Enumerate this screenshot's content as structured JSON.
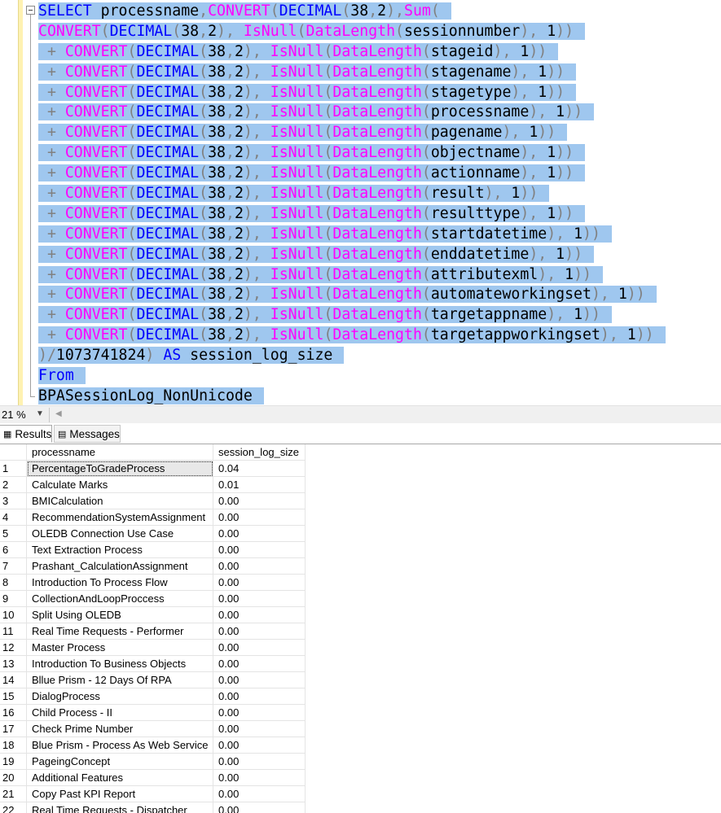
{
  "editor": {
    "lines": [
      [
        [
          "kw",
          "SELECT"
        ],
        [
          "tx",
          " processname"
        ],
        [
          "gr",
          ","
        ],
        [
          "fn",
          "CONVERT"
        ],
        [
          "gr",
          "("
        ],
        [
          "kw",
          "DECIMAL"
        ],
        [
          "gr",
          "("
        ],
        [
          "tx",
          "38"
        ],
        [
          "gr",
          ","
        ],
        [
          "tx",
          "2"
        ],
        [
          "gr",
          "),"
        ],
        [
          "fn",
          "Sum"
        ],
        [
          "gr",
          "("
        ]
      ],
      [
        [
          "fn",
          "CONVERT"
        ],
        [
          "gr",
          "("
        ],
        [
          "kw",
          "DECIMAL"
        ],
        [
          "gr",
          "("
        ],
        [
          "tx",
          "38"
        ],
        [
          "gr",
          ","
        ],
        [
          "tx",
          "2"
        ],
        [
          "gr",
          "), "
        ],
        [
          "fn",
          "IsNull"
        ],
        [
          "gr",
          "("
        ],
        [
          "fn",
          "DataLength"
        ],
        [
          "gr",
          "("
        ],
        [
          "tx",
          "sessionnumber"
        ],
        [
          "gr",
          "), "
        ],
        [
          "tx",
          "1"
        ],
        [
          "gr",
          "))"
        ]
      ],
      [
        [
          "gr",
          " + "
        ],
        [
          "fn",
          "CONVERT"
        ],
        [
          "gr",
          "("
        ],
        [
          "kw",
          "DECIMAL"
        ],
        [
          "gr",
          "("
        ],
        [
          "tx",
          "38"
        ],
        [
          "gr",
          ","
        ],
        [
          "tx",
          "2"
        ],
        [
          "gr",
          "), "
        ],
        [
          "fn",
          "IsNull"
        ],
        [
          "gr",
          "("
        ],
        [
          "fn",
          "DataLength"
        ],
        [
          "gr",
          "("
        ],
        [
          "tx",
          "stageid"
        ],
        [
          "gr",
          "), "
        ],
        [
          "tx",
          "1"
        ],
        [
          "gr",
          "))"
        ]
      ],
      [
        [
          "gr",
          " + "
        ],
        [
          "fn",
          "CONVERT"
        ],
        [
          "gr",
          "("
        ],
        [
          "kw",
          "DECIMAL"
        ],
        [
          "gr",
          "("
        ],
        [
          "tx",
          "38"
        ],
        [
          "gr",
          ","
        ],
        [
          "tx",
          "2"
        ],
        [
          "gr",
          "), "
        ],
        [
          "fn",
          "IsNull"
        ],
        [
          "gr",
          "("
        ],
        [
          "fn",
          "DataLength"
        ],
        [
          "gr",
          "("
        ],
        [
          "tx",
          "stagename"
        ],
        [
          "gr",
          "), "
        ],
        [
          "tx",
          "1"
        ],
        [
          "gr",
          "))"
        ]
      ],
      [
        [
          "gr",
          " + "
        ],
        [
          "fn",
          "CONVERT"
        ],
        [
          "gr",
          "("
        ],
        [
          "kw",
          "DECIMAL"
        ],
        [
          "gr",
          "("
        ],
        [
          "tx",
          "38"
        ],
        [
          "gr",
          ","
        ],
        [
          "tx",
          "2"
        ],
        [
          "gr",
          "), "
        ],
        [
          "fn",
          "IsNull"
        ],
        [
          "gr",
          "("
        ],
        [
          "fn",
          "DataLength"
        ],
        [
          "gr",
          "("
        ],
        [
          "tx",
          "stagetype"
        ],
        [
          "gr",
          "), "
        ],
        [
          "tx",
          "1"
        ],
        [
          "gr",
          "))"
        ]
      ],
      [
        [
          "gr",
          " + "
        ],
        [
          "fn",
          "CONVERT"
        ],
        [
          "gr",
          "("
        ],
        [
          "kw",
          "DECIMAL"
        ],
        [
          "gr",
          "("
        ],
        [
          "tx",
          "38"
        ],
        [
          "gr",
          ","
        ],
        [
          "tx",
          "2"
        ],
        [
          "gr",
          "), "
        ],
        [
          "fn",
          "IsNull"
        ],
        [
          "gr",
          "("
        ],
        [
          "fn",
          "DataLength"
        ],
        [
          "gr",
          "("
        ],
        [
          "tx",
          "processname"
        ],
        [
          "gr",
          "), "
        ],
        [
          "tx",
          "1"
        ],
        [
          "gr",
          "))"
        ]
      ],
      [
        [
          "gr",
          " + "
        ],
        [
          "fn",
          "CONVERT"
        ],
        [
          "gr",
          "("
        ],
        [
          "kw",
          "DECIMAL"
        ],
        [
          "gr",
          "("
        ],
        [
          "tx",
          "38"
        ],
        [
          "gr",
          ","
        ],
        [
          "tx",
          "2"
        ],
        [
          "gr",
          "), "
        ],
        [
          "fn",
          "IsNull"
        ],
        [
          "gr",
          "("
        ],
        [
          "fn",
          "DataLength"
        ],
        [
          "gr",
          "("
        ],
        [
          "tx",
          "pagename"
        ],
        [
          "gr",
          "), "
        ],
        [
          "tx",
          "1"
        ],
        [
          "gr",
          "))"
        ]
      ],
      [
        [
          "gr",
          " + "
        ],
        [
          "fn",
          "CONVERT"
        ],
        [
          "gr",
          "("
        ],
        [
          "kw",
          "DECIMAL"
        ],
        [
          "gr",
          "("
        ],
        [
          "tx",
          "38"
        ],
        [
          "gr",
          ","
        ],
        [
          "tx",
          "2"
        ],
        [
          "gr",
          "), "
        ],
        [
          "fn",
          "IsNull"
        ],
        [
          "gr",
          "("
        ],
        [
          "fn",
          "DataLength"
        ],
        [
          "gr",
          "("
        ],
        [
          "tx",
          "objectname"
        ],
        [
          "gr",
          "), "
        ],
        [
          "tx",
          "1"
        ],
        [
          "gr",
          "))"
        ]
      ],
      [
        [
          "gr",
          " + "
        ],
        [
          "fn",
          "CONVERT"
        ],
        [
          "gr",
          "("
        ],
        [
          "kw",
          "DECIMAL"
        ],
        [
          "gr",
          "("
        ],
        [
          "tx",
          "38"
        ],
        [
          "gr",
          ","
        ],
        [
          "tx",
          "2"
        ],
        [
          "gr",
          "), "
        ],
        [
          "fn",
          "IsNull"
        ],
        [
          "gr",
          "("
        ],
        [
          "fn",
          "DataLength"
        ],
        [
          "gr",
          "("
        ],
        [
          "tx",
          "actionname"
        ],
        [
          "gr",
          "), "
        ],
        [
          "tx",
          "1"
        ],
        [
          "gr",
          "))"
        ]
      ],
      [
        [
          "gr",
          " + "
        ],
        [
          "fn",
          "CONVERT"
        ],
        [
          "gr",
          "("
        ],
        [
          "kw",
          "DECIMAL"
        ],
        [
          "gr",
          "("
        ],
        [
          "tx",
          "38"
        ],
        [
          "gr",
          ","
        ],
        [
          "tx",
          "2"
        ],
        [
          "gr",
          "), "
        ],
        [
          "fn",
          "IsNull"
        ],
        [
          "gr",
          "("
        ],
        [
          "fn",
          "DataLength"
        ],
        [
          "gr",
          "("
        ],
        [
          "tx",
          "result"
        ],
        [
          "gr",
          "), "
        ],
        [
          "tx",
          "1"
        ],
        [
          "gr",
          "))"
        ]
      ],
      [
        [
          "gr",
          " + "
        ],
        [
          "fn",
          "CONVERT"
        ],
        [
          "gr",
          "("
        ],
        [
          "kw",
          "DECIMAL"
        ],
        [
          "gr",
          "("
        ],
        [
          "tx",
          "38"
        ],
        [
          "gr",
          ","
        ],
        [
          "tx",
          "2"
        ],
        [
          "gr",
          "), "
        ],
        [
          "fn",
          "IsNull"
        ],
        [
          "gr",
          "("
        ],
        [
          "fn",
          "DataLength"
        ],
        [
          "gr",
          "("
        ],
        [
          "tx",
          "resulttype"
        ],
        [
          "gr",
          "), "
        ],
        [
          "tx",
          "1"
        ],
        [
          "gr",
          "))"
        ]
      ],
      [
        [
          "gr",
          " + "
        ],
        [
          "fn",
          "CONVERT"
        ],
        [
          "gr",
          "("
        ],
        [
          "kw",
          "DECIMAL"
        ],
        [
          "gr",
          "("
        ],
        [
          "tx",
          "38"
        ],
        [
          "gr",
          ","
        ],
        [
          "tx",
          "2"
        ],
        [
          "gr",
          "), "
        ],
        [
          "fn",
          "IsNull"
        ],
        [
          "gr",
          "("
        ],
        [
          "fn",
          "DataLength"
        ],
        [
          "gr",
          "("
        ],
        [
          "tx",
          "startdatetime"
        ],
        [
          "gr",
          "), "
        ],
        [
          "tx",
          "1"
        ],
        [
          "gr",
          "))"
        ]
      ],
      [
        [
          "gr",
          " + "
        ],
        [
          "fn",
          "CONVERT"
        ],
        [
          "gr",
          "("
        ],
        [
          "kw",
          "DECIMAL"
        ],
        [
          "gr",
          "("
        ],
        [
          "tx",
          "38"
        ],
        [
          "gr",
          ","
        ],
        [
          "tx",
          "2"
        ],
        [
          "gr",
          "), "
        ],
        [
          "fn",
          "IsNull"
        ],
        [
          "gr",
          "("
        ],
        [
          "fn",
          "DataLength"
        ],
        [
          "gr",
          "("
        ],
        [
          "tx",
          "enddatetime"
        ],
        [
          "gr",
          "), "
        ],
        [
          "tx",
          "1"
        ],
        [
          "gr",
          "))"
        ]
      ],
      [
        [
          "gr",
          " + "
        ],
        [
          "fn",
          "CONVERT"
        ],
        [
          "gr",
          "("
        ],
        [
          "kw",
          "DECIMAL"
        ],
        [
          "gr",
          "("
        ],
        [
          "tx",
          "38"
        ],
        [
          "gr",
          ","
        ],
        [
          "tx",
          "2"
        ],
        [
          "gr",
          "), "
        ],
        [
          "fn",
          "IsNull"
        ],
        [
          "gr",
          "("
        ],
        [
          "fn",
          "DataLength"
        ],
        [
          "gr",
          "("
        ],
        [
          "tx",
          "attributexml"
        ],
        [
          "gr",
          "), "
        ],
        [
          "tx",
          "1"
        ],
        [
          "gr",
          "))"
        ]
      ],
      [
        [
          "gr",
          " + "
        ],
        [
          "fn",
          "CONVERT"
        ],
        [
          "gr",
          "("
        ],
        [
          "kw",
          "DECIMAL"
        ],
        [
          "gr",
          "("
        ],
        [
          "tx",
          "38"
        ],
        [
          "gr",
          ","
        ],
        [
          "tx",
          "2"
        ],
        [
          "gr",
          "), "
        ],
        [
          "fn",
          "IsNull"
        ],
        [
          "gr",
          "("
        ],
        [
          "fn",
          "DataLength"
        ],
        [
          "gr",
          "("
        ],
        [
          "tx",
          "automateworkingset"
        ],
        [
          "gr",
          "), "
        ],
        [
          "tx",
          "1"
        ],
        [
          "gr",
          "))"
        ]
      ],
      [
        [
          "gr",
          " + "
        ],
        [
          "fn",
          "CONVERT"
        ],
        [
          "gr",
          "("
        ],
        [
          "kw",
          "DECIMAL"
        ],
        [
          "gr",
          "("
        ],
        [
          "tx",
          "38"
        ],
        [
          "gr",
          ","
        ],
        [
          "tx",
          "2"
        ],
        [
          "gr",
          "), "
        ],
        [
          "fn",
          "IsNull"
        ],
        [
          "gr",
          "("
        ],
        [
          "fn",
          "DataLength"
        ],
        [
          "gr",
          "("
        ],
        [
          "tx",
          "targetappname"
        ],
        [
          "gr",
          "), "
        ],
        [
          "tx",
          "1"
        ],
        [
          "gr",
          "))"
        ]
      ],
      [
        [
          "gr",
          " + "
        ],
        [
          "fn",
          "CONVERT"
        ],
        [
          "gr",
          "("
        ],
        [
          "kw",
          "DECIMAL"
        ],
        [
          "gr",
          "("
        ],
        [
          "tx",
          "38"
        ],
        [
          "gr",
          ","
        ],
        [
          "tx",
          "2"
        ],
        [
          "gr",
          "), "
        ],
        [
          "fn",
          "IsNull"
        ],
        [
          "gr",
          "("
        ],
        [
          "fn",
          "DataLength"
        ],
        [
          "gr",
          "("
        ],
        [
          "tx",
          "targetappworkingset"
        ],
        [
          "gr",
          "), "
        ],
        [
          "tx",
          "1"
        ],
        [
          "gr",
          "))"
        ]
      ],
      [
        [
          "gr",
          ")/"
        ],
        [
          "tx",
          "1073741824"
        ],
        [
          "gr",
          ") "
        ],
        [
          "kw",
          "AS"
        ],
        [
          "tx",
          " session_log_size"
        ]
      ],
      [
        [
          "kw",
          "From"
        ]
      ],
      [
        [
          "tx",
          "BPASessionLog_NonUnicode"
        ]
      ]
    ]
  },
  "zoom": {
    "value": "21 %"
  },
  "tabs": {
    "results": "Results",
    "messages": "Messages"
  },
  "grid": {
    "columns": [
      "processname",
      "session_log_size"
    ],
    "rows": [
      [
        "1",
        "PercentageToGradeProcess",
        "0.04"
      ],
      [
        "2",
        "Calculate Marks",
        "0.01"
      ],
      [
        "3",
        "BMICalculation",
        "0.00"
      ],
      [
        "4",
        "RecommendationSystemAssignment",
        "0.00"
      ],
      [
        "5",
        "OLEDB Connection Use Case",
        "0.00"
      ],
      [
        "6",
        "Text Extraction Process",
        "0.00"
      ],
      [
        "7",
        "Prashant_CalculationAssignment",
        "0.00"
      ],
      [
        "8",
        "Introduction To Process Flow",
        "0.00"
      ],
      [
        "9",
        "CollectionAndLoopProccess",
        "0.00"
      ],
      [
        "10",
        "Split Using OLEDB",
        "0.00"
      ],
      [
        "11",
        "Real Time Requests - Performer",
        "0.00"
      ],
      [
        "12",
        "Master Process",
        "0.00"
      ],
      [
        "13",
        "Introduction To Business Objects",
        "0.00"
      ],
      [
        "14",
        "Bllue Prism - 12 Days Of RPA",
        "0.00"
      ],
      [
        "15",
        "DialogProcess",
        "0.00"
      ],
      [
        "16",
        "Child Process - II",
        "0.00"
      ],
      [
        "17",
        "Check Prime Number",
        "0.00"
      ],
      [
        "18",
        "Blue Prism - Process As Web Service",
        "0.00"
      ],
      [
        "19",
        "PageingConcept",
        "0.00"
      ],
      [
        "20",
        "Additional Features",
        "0.00"
      ],
      [
        "21",
        "Copy Past KPI Report",
        "0.00"
      ],
      [
        "22",
        "Real Time Requests - Dispatcher",
        "0.00"
      ]
    ]
  },
  "colors": {
    "keyword": "#0000ff",
    "function": "#ff00ff",
    "operator": "#808080",
    "selection": "#9fc7ef"
  }
}
